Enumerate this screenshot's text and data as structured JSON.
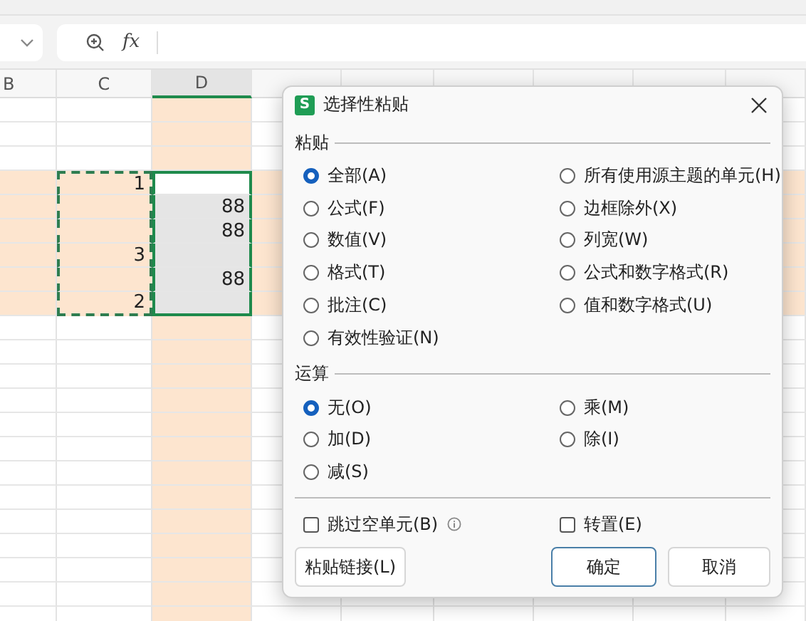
{
  "formula_bar": {
    "function_label": "fx"
  },
  "columns": [
    {
      "label": "B",
      "selected": false
    },
    {
      "label": "C",
      "selected": false
    },
    {
      "label": "D",
      "selected": true
    },
    {
      "selected": false
    },
    {
      "selected": false
    },
    {
      "selected": false
    },
    {
      "selected": false
    },
    {
      "selected": false
    },
    {
      "selected": false
    }
  ],
  "rows": [
    {
      "highlighted": false,
      "selected": false,
      "copied": false
    },
    {
      "highlighted": false,
      "selected": false,
      "copied": false
    },
    {
      "highlighted": false,
      "selected": false,
      "copied": false
    },
    {
      "highlighted": true,
      "selected": true,
      "copied": true,
      "c": "1"
    },
    {
      "highlighted": true,
      "selected": true,
      "copied": true,
      "d": "88"
    },
    {
      "highlighted": true,
      "selected": true,
      "copied": true,
      "d": "88"
    },
    {
      "highlighted": true,
      "selected": true,
      "copied": true,
      "c": "3"
    },
    {
      "highlighted": true,
      "selected": true,
      "copied": true,
      "d": "88"
    },
    {
      "highlighted": true,
      "selected": true,
      "copied": true,
      "c": "2"
    },
    {
      "highlighted": false,
      "selected": false,
      "copied": false
    },
    {
      "highlighted": false,
      "selected": false,
      "copied": false
    },
    {
      "highlighted": false,
      "selected": false,
      "copied": false
    },
    {
      "highlighted": false,
      "selected": false,
      "copied": false
    },
    {
      "highlighted": false,
      "selected": false,
      "copied": false
    },
    {
      "highlighted": false,
      "selected": false,
      "copied": false
    },
    {
      "highlighted": false,
      "selected": false,
      "copied": false
    },
    {
      "highlighted": false,
      "selected": false,
      "copied": false
    },
    {
      "highlighted": false,
      "selected": false,
      "copied": false
    },
    {
      "highlighted": false,
      "selected": false,
      "copied": false
    },
    {
      "highlighted": false,
      "selected": false,
      "copied": false
    },
    {
      "highlighted": false,
      "selected": false,
      "copied": false
    },
    {
      "highlighted": false,
      "selected": false,
      "copied": false
    }
  ],
  "dialog": {
    "logo": "S",
    "title": "选择性粘贴",
    "paste": {
      "label": "粘贴",
      "options": [
        {
          "label": "全部(A)",
          "selected": true
        },
        {
          "label": "所有使用源主题的单元(H)",
          "selected": false
        },
        {
          "label": "公式(F)",
          "selected": false
        },
        {
          "label": "边框除外(X)",
          "selected": false
        },
        {
          "label": "数值(V)",
          "selected": false
        },
        {
          "label": "列宽(W)",
          "selected": false
        },
        {
          "label": "格式(T)",
          "selected": false
        },
        {
          "label": "公式和数字格式(R)",
          "selected": false
        },
        {
          "label": "批注(C)",
          "selected": false
        },
        {
          "label": "值和数字格式(U)",
          "selected": false
        },
        {
          "label": "有效性验证(N)",
          "selected": false
        }
      ]
    },
    "operation": {
      "label": "运算",
      "options": [
        {
          "label": "无(O)",
          "selected": true
        },
        {
          "label": "乘(M)",
          "selected": false
        },
        {
          "label": "加(D)",
          "selected": false
        },
        {
          "label": "除(I)",
          "selected": false
        },
        {
          "label": "减(S)",
          "selected": false
        }
      ]
    },
    "checkboxes": [
      {
        "label": "跳过空单元(B)",
        "checked": false,
        "kind": "with_info"
      },
      {
        "label": "转置(E)",
        "checked": false,
        "kind": "plain"
      }
    ],
    "buttons": [
      {
        "label": "粘贴链接(L)",
        "kind": "link"
      },
      {
        "label": "确定",
        "kind": "default"
      },
      {
        "label": "取消",
        "kind": "normal"
      }
    ]
  }
}
